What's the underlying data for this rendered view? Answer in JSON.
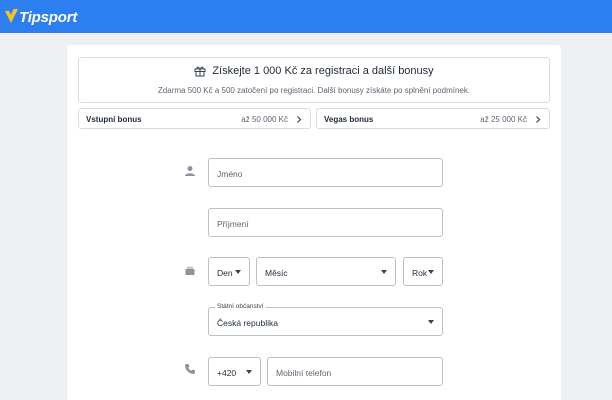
{
  "header": {
    "brand": "Tipsport",
    "brand_color": "#2d7ef0",
    "logo_icon": "tipsport-check-logo"
  },
  "promo": {
    "icon": "gift-icon",
    "title": "Získejte 1 000 Kč za registraci a další bonusy",
    "subtitle": "Zdarma 500 Kč a 500 zatočení po registraci. Další bonusy získáte po splnění podmínek."
  },
  "bonuses": [
    {
      "label": "Vstupní bonus",
      "value": "až 50 000 Kč"
    },
    {
      "label": "Vegas bonus",
      "value": "až 25 000 Kč"
    }
  ],
  "form": {
    "first_name_placeholder": "Jméno",
    "last_name_placeholder": "Příjmení",
    "day_label": "Den",
    "month_label": "Měsíc",
    "year_label": "Rok",
    "citizenship_label": "Státní občanství",
    "citizenship_value": "Česká republika",
    "phone_prefix": "+420",
    "phone_placeholder": "Mobilní telefon",
    "icons": [
      "person-icon",
      "birthday-cake-icon",
      "phone-icon"
    ]
  }
}
